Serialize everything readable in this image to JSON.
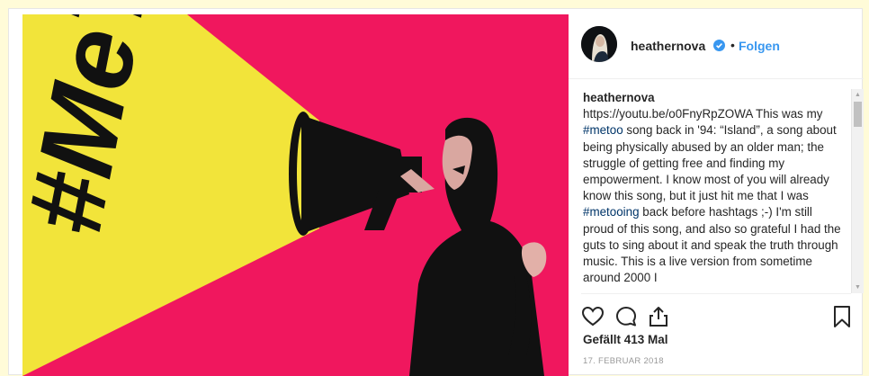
{
  "post": {
    "image_text": "#MeToo",
    "username": "heathernova",
    "follow_label": "Folgen",
    "separator": "•",
    "caption": {
      "user": "heathernova",
      "seg1": "https://youtu.be/o0FnyRpZOWA This was my ",
      "tag1": "#metoo",
      "seg2": " song back in '94: “Island”, a song about being physically abused by an older man; the struggle of getting free and finding my empowerment. I know most of you will already know this song, but it just hit me that I was ",
      "tag2": "#metooing",
      "seg3": " back before hashtags ;-) I'm still proud of this song, and also so grateful I had the guts to sing about it and speak the truth through music. This is a live version from sometime around 2000 I"
    },
    "likes": "Gefällt 413 Mal",
    "date": "17. FEBRUAR 2018"
  },
  "colors": {
    "page_bg": "#fffbd8",
    "image_bg": "#f0175e",
    "image_beam": "#f2e43a",
    "link_blue": "#3897f0",
    "verified_blue": "#3897f0"
  },
  "icons": {
    "like": "heart-icon",
    "comment": "comment-icon",
    "share": "share-icon",
    "save": "bookmark-icon",
    "verified": "verified-badge-icon"
  }
}
